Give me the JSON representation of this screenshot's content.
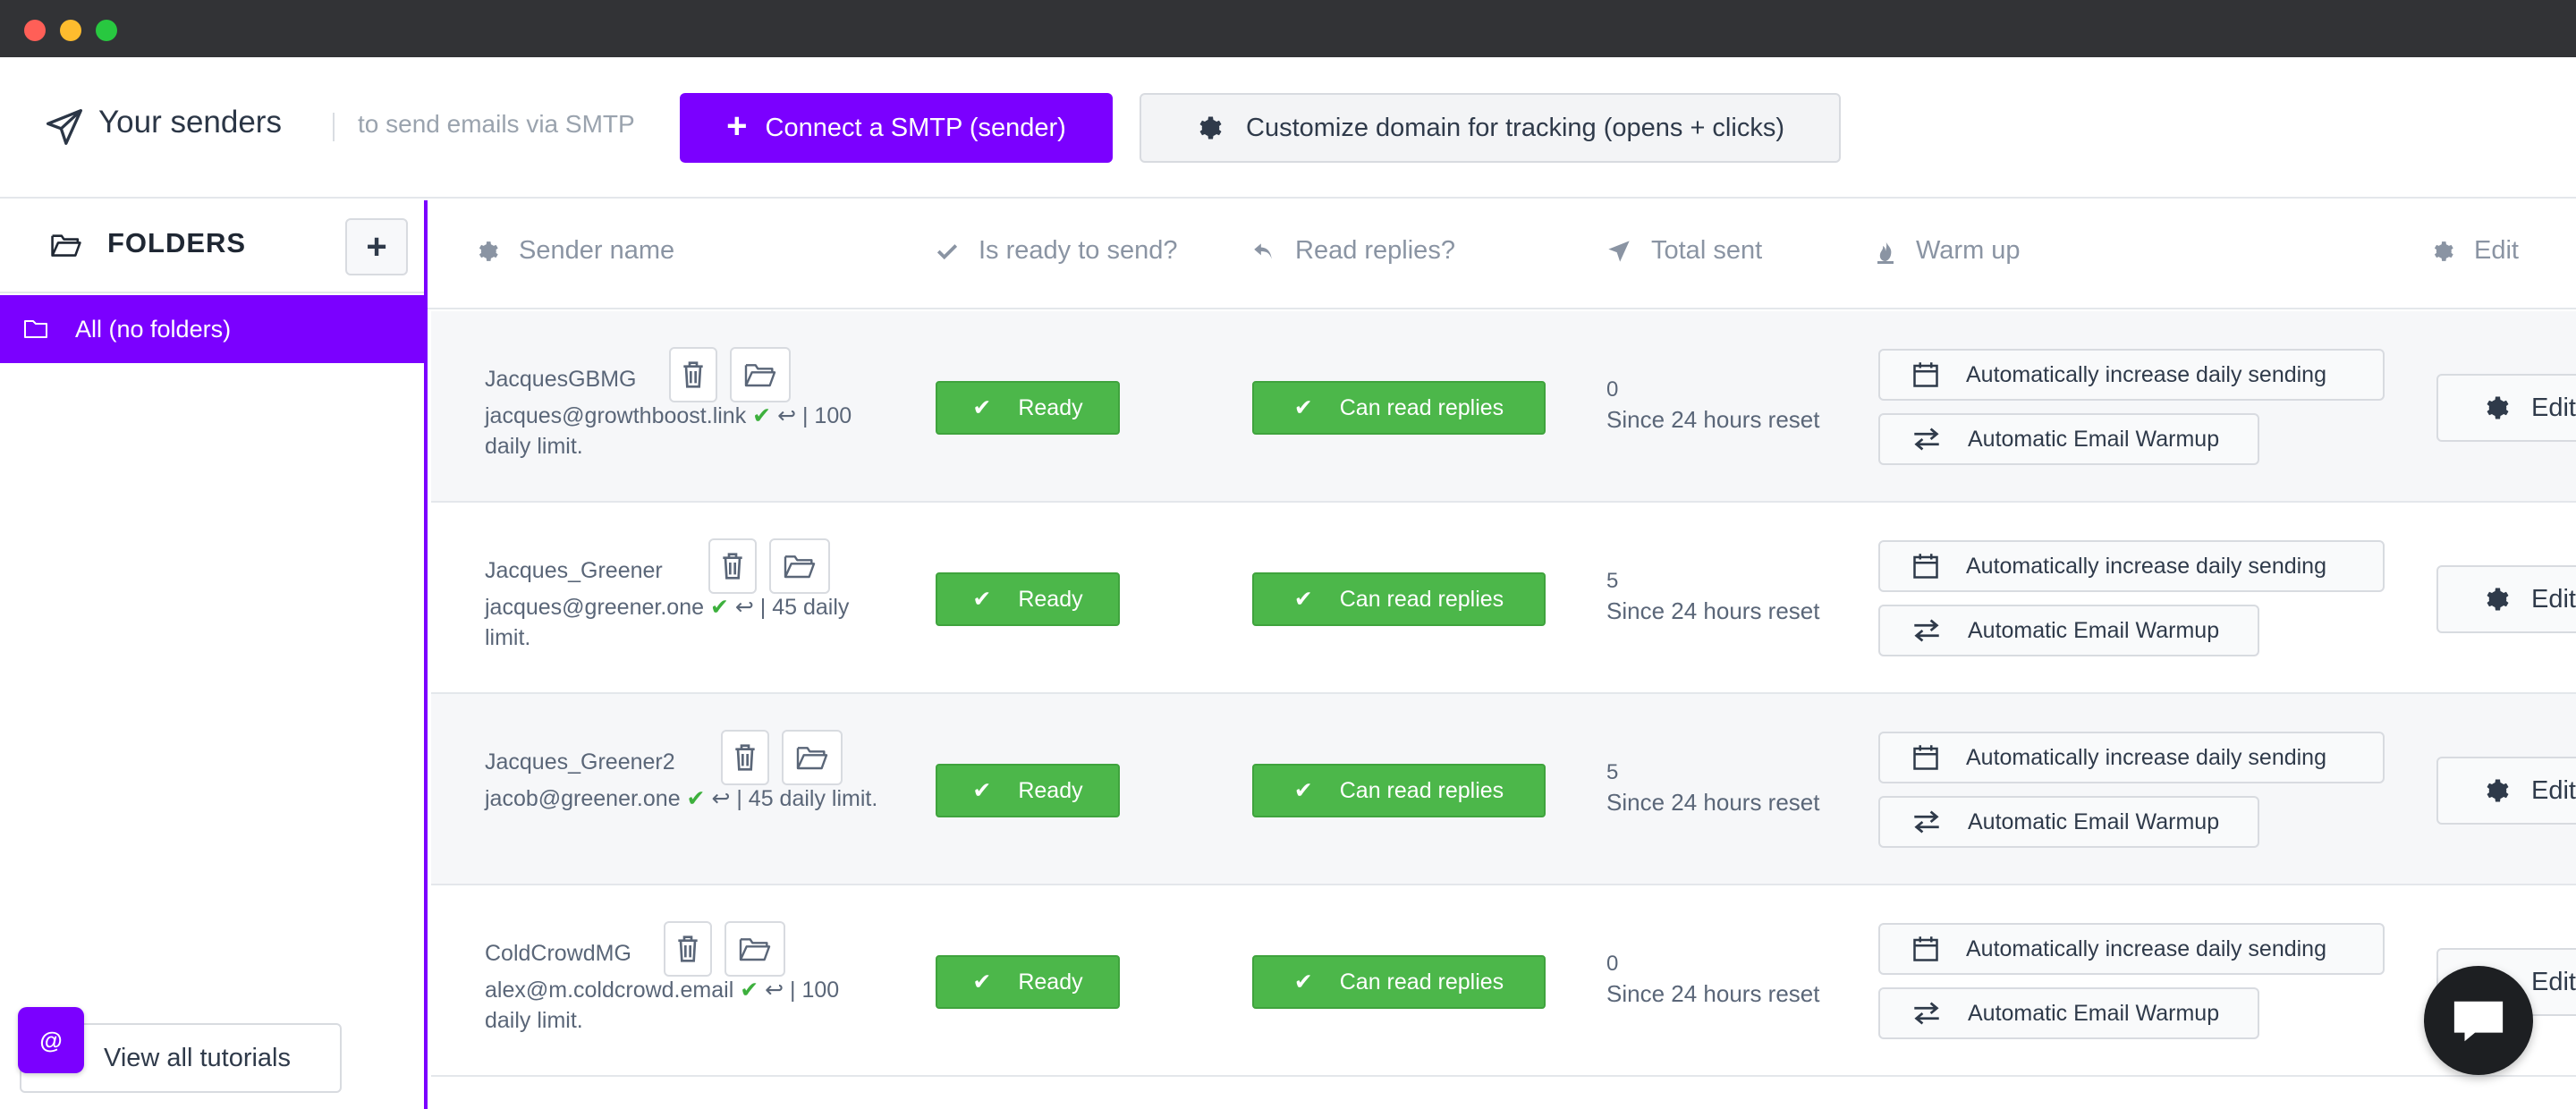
{
  "window": {
    "controls": [
      "close",
      "minimize",
      "maximize"
    ]
  },
  "header": {
    "title": "Your senders",
    "subtitle": "to send emails via SMTP",
    "connect_label": "Connect a SMTP (sender)",
    "customize_label": "Customize domain for tracking (opens + clicks)",
    "icons": {
      "title": "paper-plane-icon",
      "connect": "plus-icon",
      "customize": "gear-icon"
    }
  },
  "sidebar": {
    "folders_label": "FOLDERS",
    "add_folder_label": "+",
    "all_folder_label": "All (no folders)",
    "tutorials_label": "View all tutorials",
    "badge_label": "@"
  },
  "table": {
    "columns": [
      "Sender name",
      "Is ready to send?",
      "Read replies?",
      "Total sent",
      "Warm up",
      "Edit"
    ],
    "rows": [
      {
        "name": "JacquesGBMG",
        "email": "jacques@growthboost.link",
        "limit_text": "| 100 daily limit.",
        "ready_label": "Ready",
        "replies_label": "Can read replies",
        "total_sent": "0",
        "sent_note": "Since 24 hours reset",
        "warm1_label": "Automatically increase daily sending",
        "warm2_label": "Automatic Email Warmup",
        "edit_label": "Edit"
      },
      {
        "name": "Jacques_Greener",
        "email": "jacques@greener.one",
        "limit_text": "| 45 daily limit.",
        "ready_label": "Ready",
        "replies_label": "Can read replies",
        "total_sent": "5",
        "sent_note": "Since 24 hours reset",
        "warm1_label": "Automatically increase daily sending",
        "warm2_label": "Automatic Email Warmup",
        "edit_label": "Edit"
      },
      {
        "name": "Jacques_Greener2",
        "email": "jacob@greener.one",
        "limit_text": "| 45 daily limit.",
        "ready_label": "Ready",
        "replies_label": "Can read replies",
        "total_sent": "5",
        "sent_note": "Since 24 hours reset",
        "warm1_label": "Automatically increase daily sending",
        "warm2_label": "Automatic Email Warmup",
        "edit_label": "Edit"
      },
      {
        "name": "ColdCrowdMG",
        "email": "alex@m.coldcrowd.email",
        "limit_text": "| 100 daily limit.",
        "ready_label": "Ready",
        "replies_label": "Can read replies",
        "total_sent": "0",
        "sent_note": "Since 24 hours reset",
        "warm1_label": "Automatically increase daily sending",
        "warm2_label": "Automatic Email Warmup",
        "edit_label": "Edit"
      }
    ]
  },
  "colors": {
    "accent": "#7b00ff",
    "success": "#4cb74a",
    "titlebar": "#323336"
  }
}
